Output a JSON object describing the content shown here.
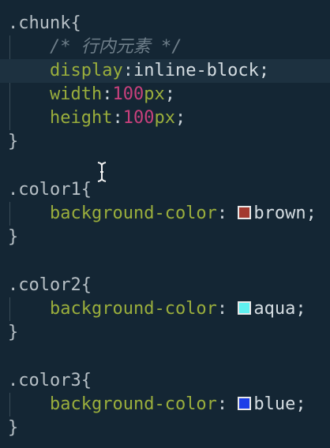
{
  "editor": {
    "blocks": [
      {
        "selector": ".chunk{",
        "comment": "/* 行内元素 */",
        "lines": [
          {
            "prop": "display",
            "value": "inline-block;"
          },
          {
            "prop": "width",
            "num": "100",
            "unit": "px",
            "end": ";"
          },
          {
            "prop": "height",
            "num": "100",
            "unit": "px",
            "end": ";"
          }
        ],
        "close": "}"
      },
      {
        "selector": ".color1{",
        "prop": "background-color",
        "value": "brown;",
        "swatch": "#a33a30",
        "close": "}"
      },
      {
        "selector": ".color2{",
        "prop": "background-color",
        "value": "aqua;",
        "swatch": "#5ff0f0",
        "close": "}"
      },
      {
        "selector": ".color3{",
        "prop": "background-color",
        "value": "blue;",
        "swatch": "#1c3ee8",
        "close": "}"
      }
    ],
    "colon": ":",
    "colon_space": ": ",
    "cursor_icon": "text-cursor-i-beam"
  }
}
